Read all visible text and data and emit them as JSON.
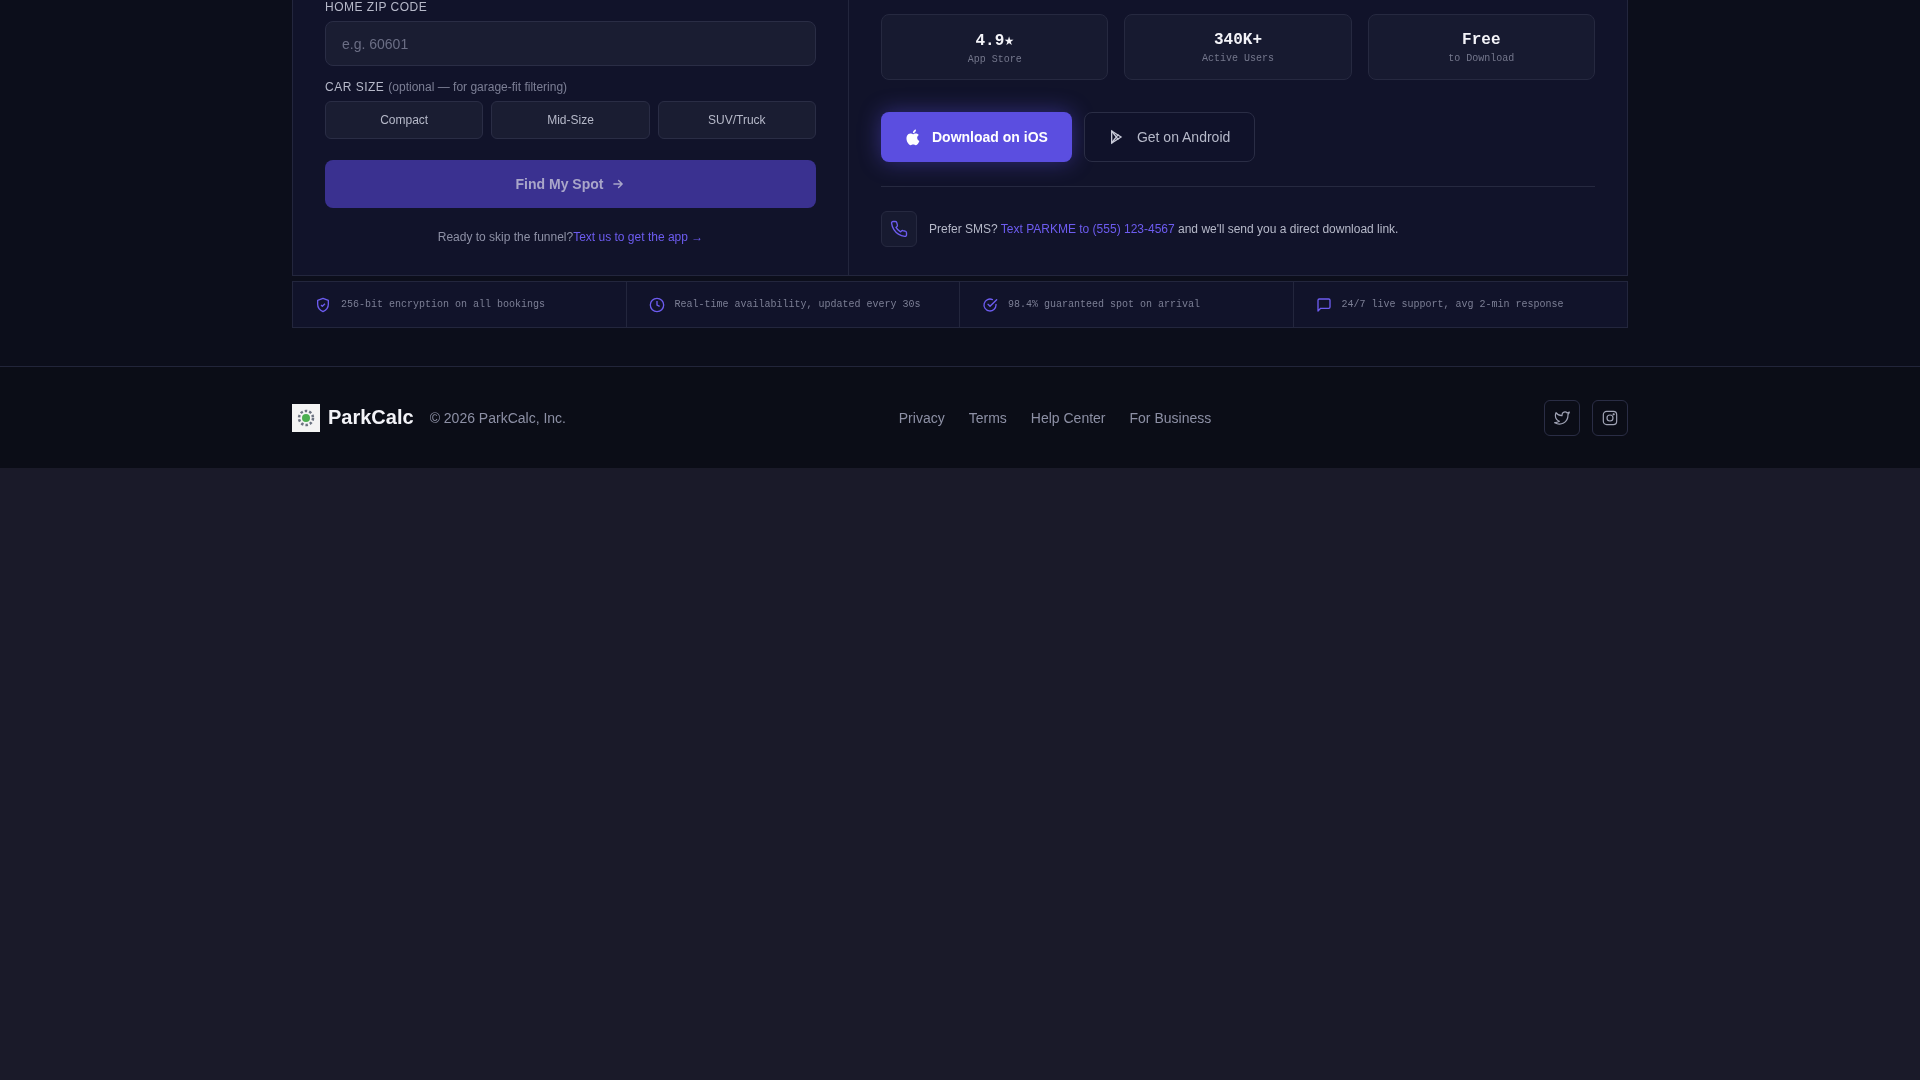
{
  "form": {
    "zip_label": "HOME ZIP CODE",
    "zip_placeholder": "e.g. 60601",
    "car_size_label": "CAR SIZE",
    "car_size_hint": "(optional — for garage-fit filtering)",
    "car_sizes": [
      {
        "label": "Compact",
        "selected": false
      },
      {
        "label": "Mid-Size",
        "selected": false
      },
      {
        "label": "SUV/Truck",
        "selected": false
      }
    ],
    "submit": "Find My Spot",
    "skip_text": "Ready to skip the funnel?",
    "skip_link": "Text us to get the app →"
  },
  "app": {
    "stats": [
      {
        "value": "4.9★",
        "label": "App Store"
      },
      {
        "value": "340K+",
        "label": "Active Users"
      },
      {
        "value": "Free",
        "label": "to Download"
      }
    ],
    "buttons": [
      {
        "kind": "ios",
        "label": "Download on iOS"
      },
      {
        "kind": "android",
        "label": "Get on Android"
      }
    ],
    "sms": {
      "before": "Prefer SMS?",
      "link": "Text PARKME to (555) 123-4567",
      "after": "and we'll send you a direct download link."
    }
  },
  "features": [
    {
      "kind": "shield",
      "text": "256-bit encryption on all bookings"
    },
    {
      "kind": "clock",
      "text": "Real-time availability, updated every 30s"
    },
    {
      "kind": "check",
      "text": "98.4% guaranteed spot on arrival"
    },
    {
      "kind": "chat",
      "text": "24/7 live support, avg 2-min response"
    }
  ],
  "footer": {
    "brand": "ParkCalc",
    "copyright": "© 2026 ParkCalc, Inc.",
    "links": [
      "Privacy",
      "Terms",
      "Help Center",
      "For Business"
    ],
    "social": [
      {
        "kind": "twitter"
      },
      {
        "kind": "instagram"
      }
    ]
  }
}
